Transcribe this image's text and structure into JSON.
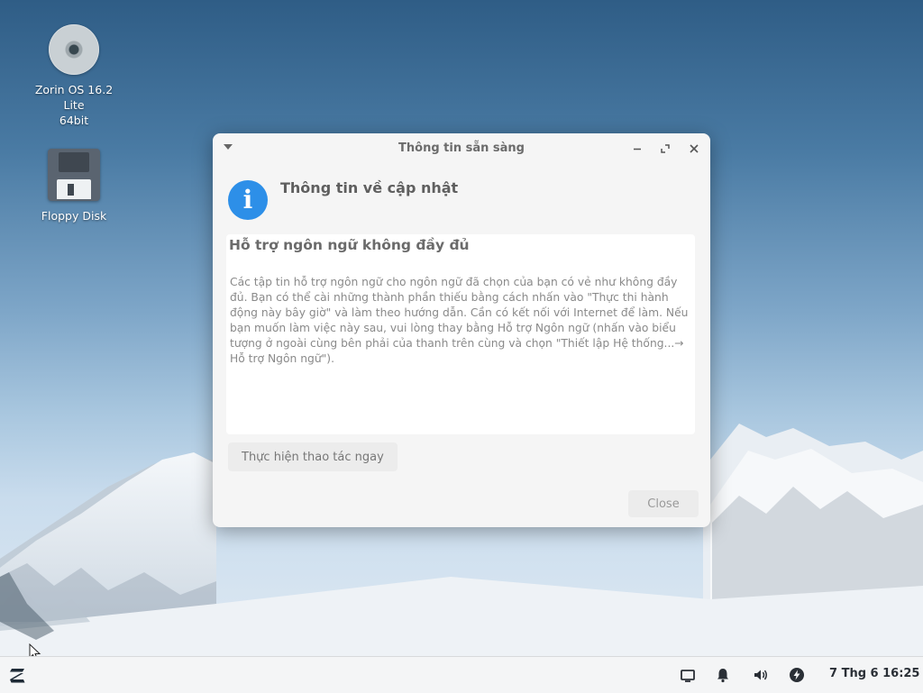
{
  "desktop": {
    "icons": [
      {
        "label_line1": "Zorin OS 16.2 Lite",
        "label_line2": "64bit",
        "icon": "disc-icon"
      },
      {
        "label_line1": "Floppy Disk",
        "icon": "floppy-disk-icon"
      }
    ]
  },
  "dialog": {
    "title": "Thông tin sẵn sàng",
    "heading": "Thông tin về cập nhật",
    "section_title": "Hỗ trợ ngôn ngữ không đầy đủ",
    "message": "Các tập tin hỗ trợ ngôn ngữ cho ngôn ngữ đã chọn của bạn có vẻ như không đầy đủ. Bạn có thể cài những thành phần thiếu bằng cách nhấn vào \"Thực thi hành động này bây giờ\" và làm theo hướng dẫn. Cần có kết nối với Internet để làm. Nếu bạn muốn làm việc này sau, vui lòng thay bằng Hỗ trợ Ngôn ngữ (nhấn vào biểu tượng ở ngoài cùng bên phải của thanh trên cùng và chọn \"Thiết lập Hệ thống...→ Hỗ trợ Ngôn ngữ\").",
    "action_button": "Thực hiện thao tác ngay",
    "close_button": "Close",
    "accent_color": "#2d8fe8"
  },
  "taskbar": {
    "clock": "7 Thg 6 16:25",
    "tray_icons": [
      "screen-icon",
      "bell-icon",
      "volume-icon",
      "power-icon"
    ]
  }
}
